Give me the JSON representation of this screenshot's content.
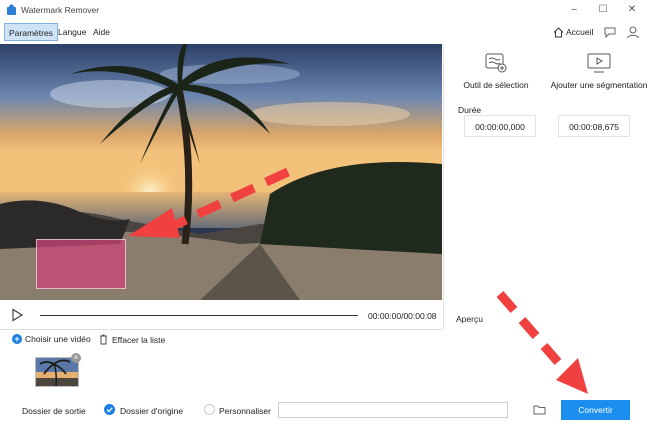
{
  "app": {
    "title": "Watermark Remover"
  },
  "menu": {
    "items": [
      "Paramètres",
      "Langue",
      "Aide"
    ],
    "active_index": 0
  },
  "header": {
    "home_label": "Accueil"
  },
  "tools": {
    "selection_label": "Outil de sélection",
    "segment_label": "Ajouter une ségmentation"
  },
  "duration": {
    "label": "Durée",
    "start": "00:00:00,000",
    "end": "00:00:08,675"
  },
  "player": {
    "time": "00:00:00/00:00:08",
    "progress": 0
  },
  "preview": {
    "label": "Aperçu"
  },
  "list": {
    "add_label": "Choisir une vidéo",
    "clear_label": "Effacer la liste"
  },
  "output": {
    "label": "Dossier de sortie",
    "option_original": "Dossier d'origine",
    "option_custom": "Personnaliser",
    "selected": "Dossier d'origine",
    "path_value": ""
  },
  "convert": {
    "label": "Convertir"
  },
  "colors": {
    "accent": "#1b8ff0",
    "annotation_arrow": "#f04040",
    "selection_box": "#cc4678"
  }
}
